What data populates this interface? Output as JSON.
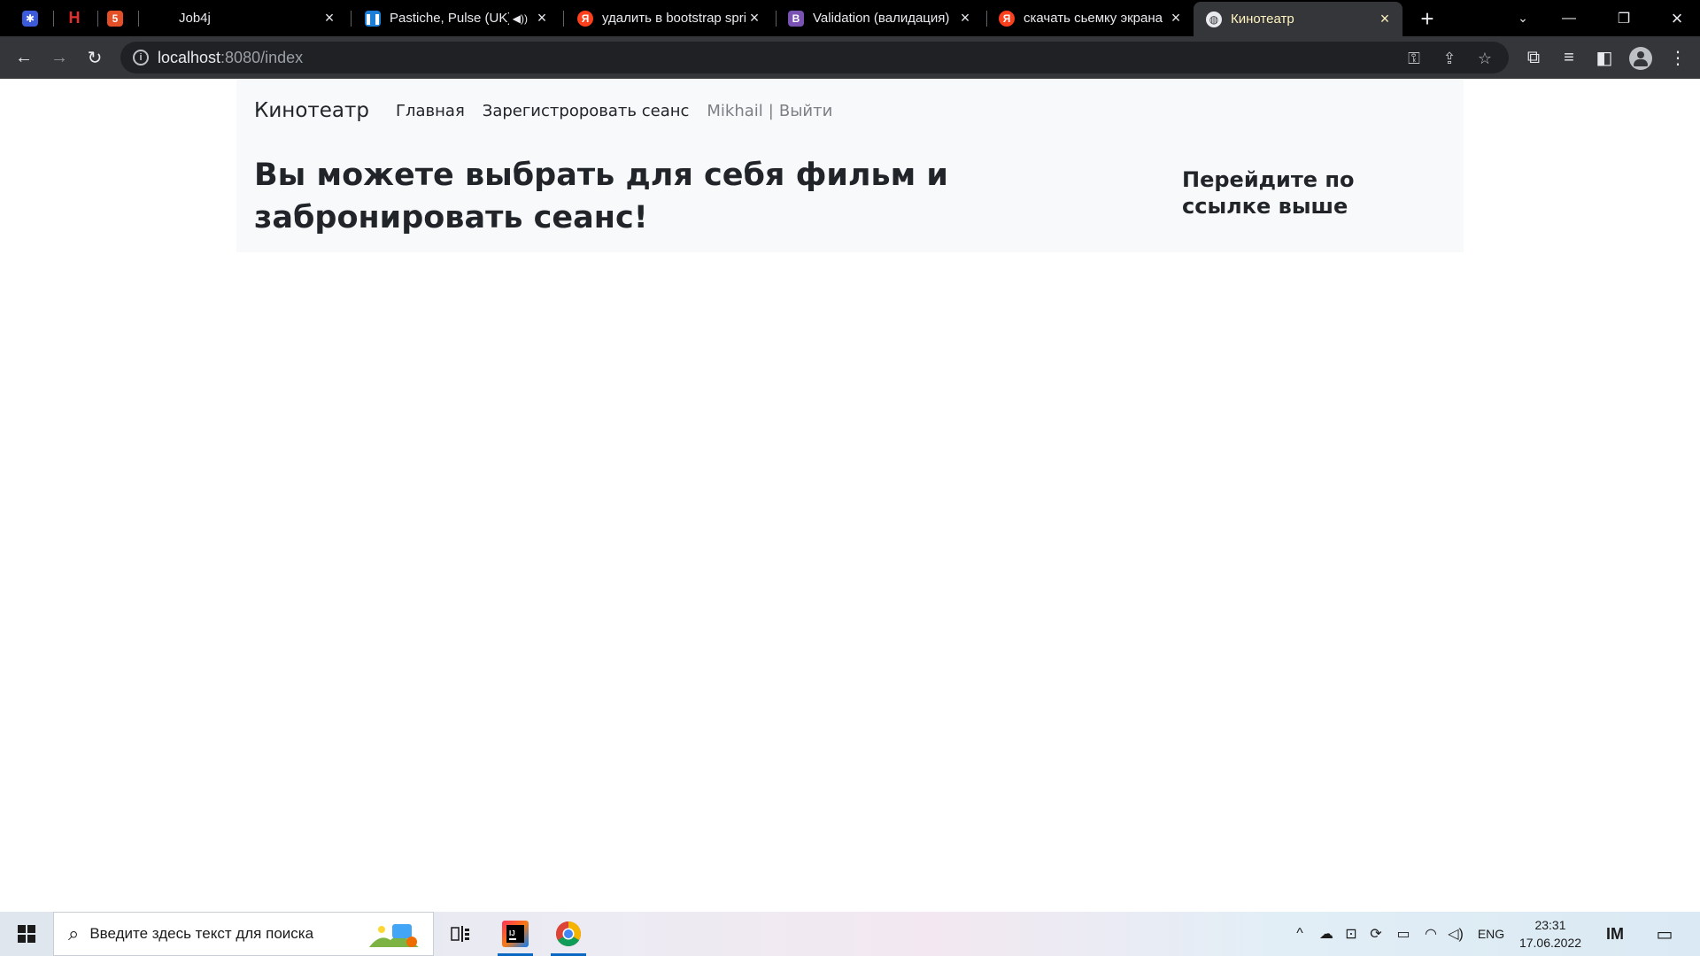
{
  "browser": {
    "tabs": [
      {
        "title": "",
        "icon": "puzzle-app-icon",
        "color": "#3b5bdb"
      },
      {
        "title": "",
        "icon": "h-logo-icon",
        "color": "#e03131"
      },
      {
        "title": "",
        "icon": "html5-icon",
        "color": "#e34f26"
      },
      {
        "title": "Job4j",
        "icon": "blank-page-icon"
      },
      {
        "title": "Pastiche, Pulse (UK)",
        "icon": "pause-icon",
        "color": "#1c7ed6",
        "audio": true
      },
      {
        "title": "удалить в bootstrap spring",
        "icon": "yandex-icon",
        "color": "#fc3f1d"
      },
      {
        "title": "Validation (валидация)",
        "icon": "bootstrap-icon",
        "color": "#7952b3"
      },
      {
        "title": "скачать сьемку экрана",
        "icon": "yandex-icon",
        "color": "#fc3f1d"
      },
      {
        "title": "Кинотеатр",
        "icon": "globe-icon",
        "active": true
      }
    ],
    "address": {
      "host": "localhost",
      "path": ":8080/index"
    }
  },
  "page": {
    "navbar": {
      "brand": "Кинотеатр",
      "links": [
        "Главная",
        "Зарегистроровать сеанс"
      ],
      "user": "Mikhail",
      "separator": "|",
      "logout": "Выйти"
    },
    "hero": {
      "title": "Вы можете выбрать для себя фильм и забронировать сеанс!",
      "side_text": "Перейдите по ссылке выше"
    }
  },
  "taskbar": {
    "search_placeholder": "Введите здесь текст для поиска",
    "language": "ENG",
    "time": "23:31",
    "date": "17.06.2022"
  }
}
